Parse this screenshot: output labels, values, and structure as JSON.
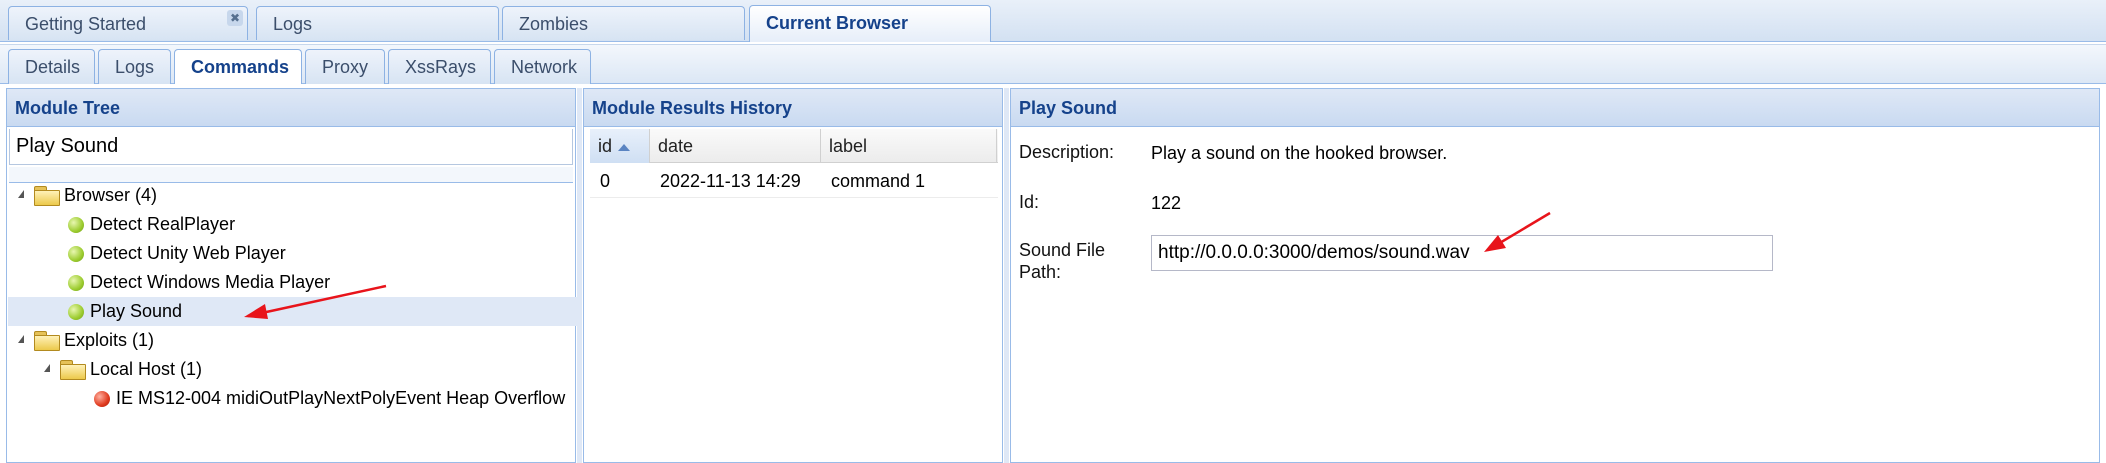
{
  "top_tabs": [
    {
      "label": "Getting Started",
      "closable": true
    },
    {
      "label": "Logs"
    },
    {
      "label": "Zombies"
    },
    {
      "label": "Current Browser",
      "active": true
    }
  ],
  "sub_tabs": [
    {
      "label": "Details"
    },
    {
      "label": "Logs"
    },
    {
      "label": "Commands",
      "active": true
    },
    {
      "label": "Proxy"
    },
    {
      "label": "XssRays"
    },
    {
      "label": "Network"
    }
  ],
  "module_tree": {
    "title": "Module Tree",
    "search_value": "Play Sound",
    "nodes": [
      {
        "label": "Browser (4)",
        "type": "folder"
      },
      {
        "label": "Detect RealPlayer",
        "type": "module",
        "status": "green"
      },
      {
        "label": "Detect Unity Web Player",
        "type": "module",
        "status": "green"
      },
      {
        "label": "Detect Windows Media Player",
        "type": "module",
        "status": "green"
      },
      {
        "label": "Play Sound",
        "type": "module",
        "status": "green",
        "selected": true
      },
      {
        "label": "Exploits (1)",
        "type": "folder"
      },
      {
        "label": "Local Host (1)",
        "type": "folder"
      },
      {
        "label": "IE MS12-004 midiOutPlayNextPolyEvent Heap Overflow",
        "type": "module",
        "status": "red"
      }
    ]
  },
  "results_history": {
    "title": "Module Results History",
    "columns": [
      "id",
      "date",
      "label"
    ],
    "rows": [
      {
        "id": "0",
        "date": "2022-11-13 14:29",
        "label": "command 1"
      }
    ]
  },
  "module_detail": {
    "title": "Play Sound",
    "description_label": "Description:",
    "description_value": "Play a sound on the hooked browser.",
    "id_label": "Id:",
    "id_value": "122",
    "sound_path_label_line1": "Sound File",
    "sound_path_label_line2": "Path:",
    "sound_path_value": "http://0.0.0.0:3000/demos/sound.wav"
  },
  "colors": {
    "accent": "#15428b",
    "border": "#99bbe8",
    "annotation_arrow": "#e8141b"
  }
}
